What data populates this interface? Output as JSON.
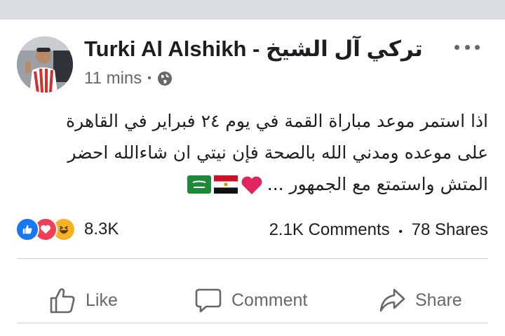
{
  "post": {
    "author": "تركي آل الشيخ - Turki Al Alshikh",
    "time": "11 mins",
    "separator": "•",
    "privacy_icon": "globe-icon",
    "lines": [
      "اذا استمر موعد مباراة القمة في يوم ٢٤ فبراير في القاهرة",
      "على موعده ومدني الله بالصحة فإن نيتي ان شاءالله احضر",
      "المتش واستمتع مع الجمهور ..."
    ],
    "emojis": [
      "red-heart",
      "egypt-flag",
      "saudi-flag"
    ]
  },
  "stats": {
    "reaction_icons": [
      "like",
      "love",
      "haha"
    ],
    "reaction_count": "8.3K",
    "comments": "2.1K Comments",
    "shares": "78 Shares",
    "separator": "•"
  },
  "actions": {
    "like": "Like",
    "comment": "Comment",
    "share": "Share"
  },
  "colors": {
    "top_bar": "#dadde1",
    "secondary_text": "#65676b",
    "like_blue": "#1877f2",
    "love_red": "#f33e58",
    "haha_yellow": "#f7b125"
  }
}
